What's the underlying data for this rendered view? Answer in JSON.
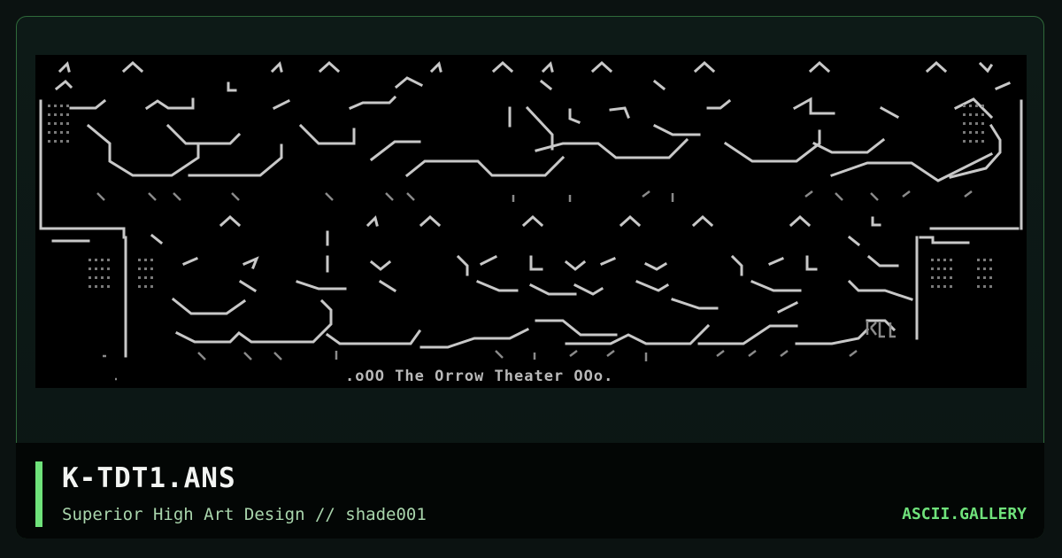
{
  "artwork": {
    "filename": "K-TDT1.ANS",
    "caption": ".oOO The Orrow Theater OOo.",
    "colors": {
      "art_fg": "#c8c8c8",
      "art_dim": "#8a8a8a",
      "art_bg": "#000000"
    }
  },
  "footer": {
    "title": "K-TDT1.ANS",
    "subtitle": "Superior High Art Design // shade001",
    "brand": "ASCII.GALLERY"
  },
  "theme": {
    "accent": "#6fe27b",
    "background": "#0b1211",
    "frame_border": "#2f6a3a"
  }
}
